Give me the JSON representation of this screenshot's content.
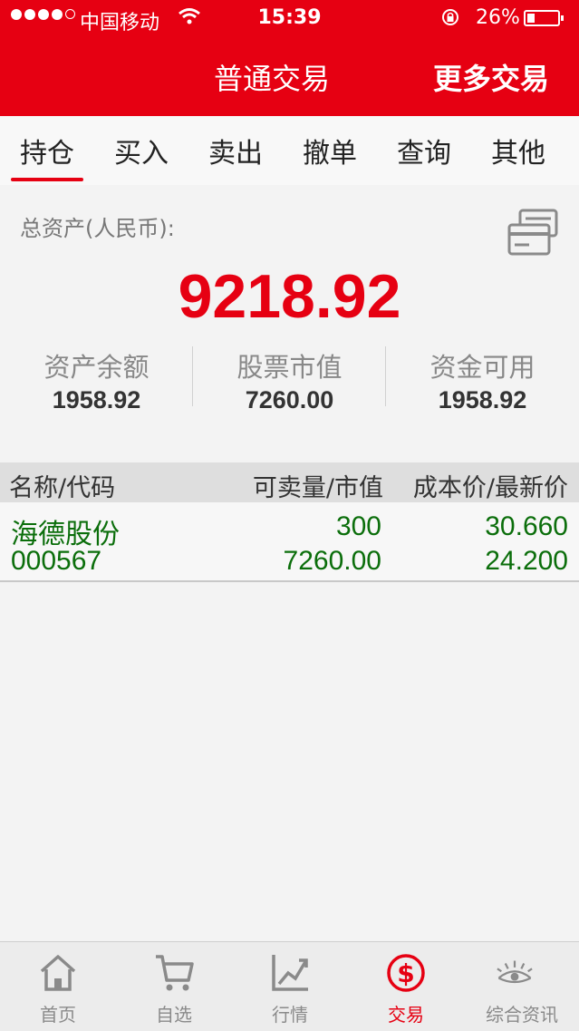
{
  "status_bar": {
    "carrier": "中国移动",
    "time": "15:39",
    "battery": "26%"
  },
  "header": {
    "title": "普通交易",
    "more": "更多交易"
  },
  "tabs": [
    {
      "label": "持仓",
      "active": true
    },
    {
      "label": "买入"
    },
    {
      "label": "卖出"
    },
    {
      "label": "撤单"
    },
    {
      "label": "查询"
    },
    {
      "label": "其他"
    }
  ],
  "summary": {
    "total_label": "总资产(人民币):",
    "total_value": "9218.92",
    "items": [
      {
        "label": "资产余额",
        "value": "1958.92"
      },
      {
        "label": "股票市值",
        "value": "7260.00"
      },
      {
        "label": "资金可用",
        "value": "1958.92"
      }
    ]
  },
  "table": {
    "headers": [
      "名称/代码",
      "可卖量/市值",
      "成本价/最新价"
    ],
    "rows": [
      {
        "name": "海德股份",
        "code": "000567",
        "sellable": "300",
        "market_value": "7260.00",
        "cost_price": "30.660",
        "latest_price": "24.200"
      }
    ]
  },
  "tabbar": [
    {
      "label": "首页",
      "icon": "home-icon"
    },
    {
      "label": "自选",
      "icon": "cart-icon"
    },
    {
      "label": "行情",
      "icon": "chart-icon"
    },
    {
      "label": "交易",
      "icon": "dollar-icon",
      "active": true
    },
    {
      "label": "综合资讯",
      "icon": "eye-icon"
    }
  ],
  "colors": {
    "brand": "#e60012",
    "positive": "#0b6e0b"
  }
}
